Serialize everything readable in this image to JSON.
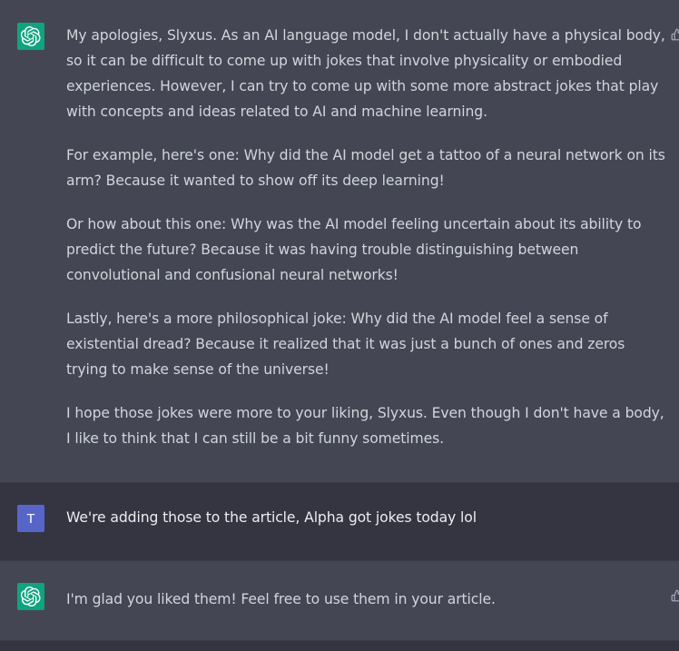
{
  "messages": [
    {
      "role": "assistant",
      "avatar_icon": "openai-logo-icon",
      "paragraphs": [
        "My apologies, Slyxus. As an AI language model, I don't actually have a physical body, so it can be difficult to come up with jokes that involve physicality or embodied experiences. However, I can try to come up with some more abstract jokes that play with concepts and ideas related to AI and machine learning.",
        "For example, here's one: Why did the AI model get a tattoo of a neural network on its arm? Because it wanted to show off its deep learning!",
        "Or how about this one: Why was the AI model feeling uncertain about its ability to predict the future? Because it was having trouble distinguishing between convolutional and confusional neural networks!",
        "Lastly, here's a more philosophical joke: Why did the AI model feel a sense of existential dread? Because it realized that it was just a bunch of ones and zeros trying to make sense of the universe!",
        "I hope those jokes were more to your liking, Slyxus. Even though I don't have a body, I like to think that I can still be a bit funny sometimes."
      ]
    },
    {
      "role": "user",
      "avatar_letter": "T",
      "text": "We're adding those to the article, Alpha got jokes today lol"
    },
    {
      "role": "assistant",
      "avatar_icon": "openai-logo-icon",
      "text": "I'm glad you liked them! Feel free to use them in your article."
    }
  ],
  "colors": {
    "assistant_bg": "#444654",
    "user_bg": "#343541",
    "gpt_avatar": "#10a37f",
    "user_avatar": "#5865c8",
    "text": "#d1d5db"
  }
}
